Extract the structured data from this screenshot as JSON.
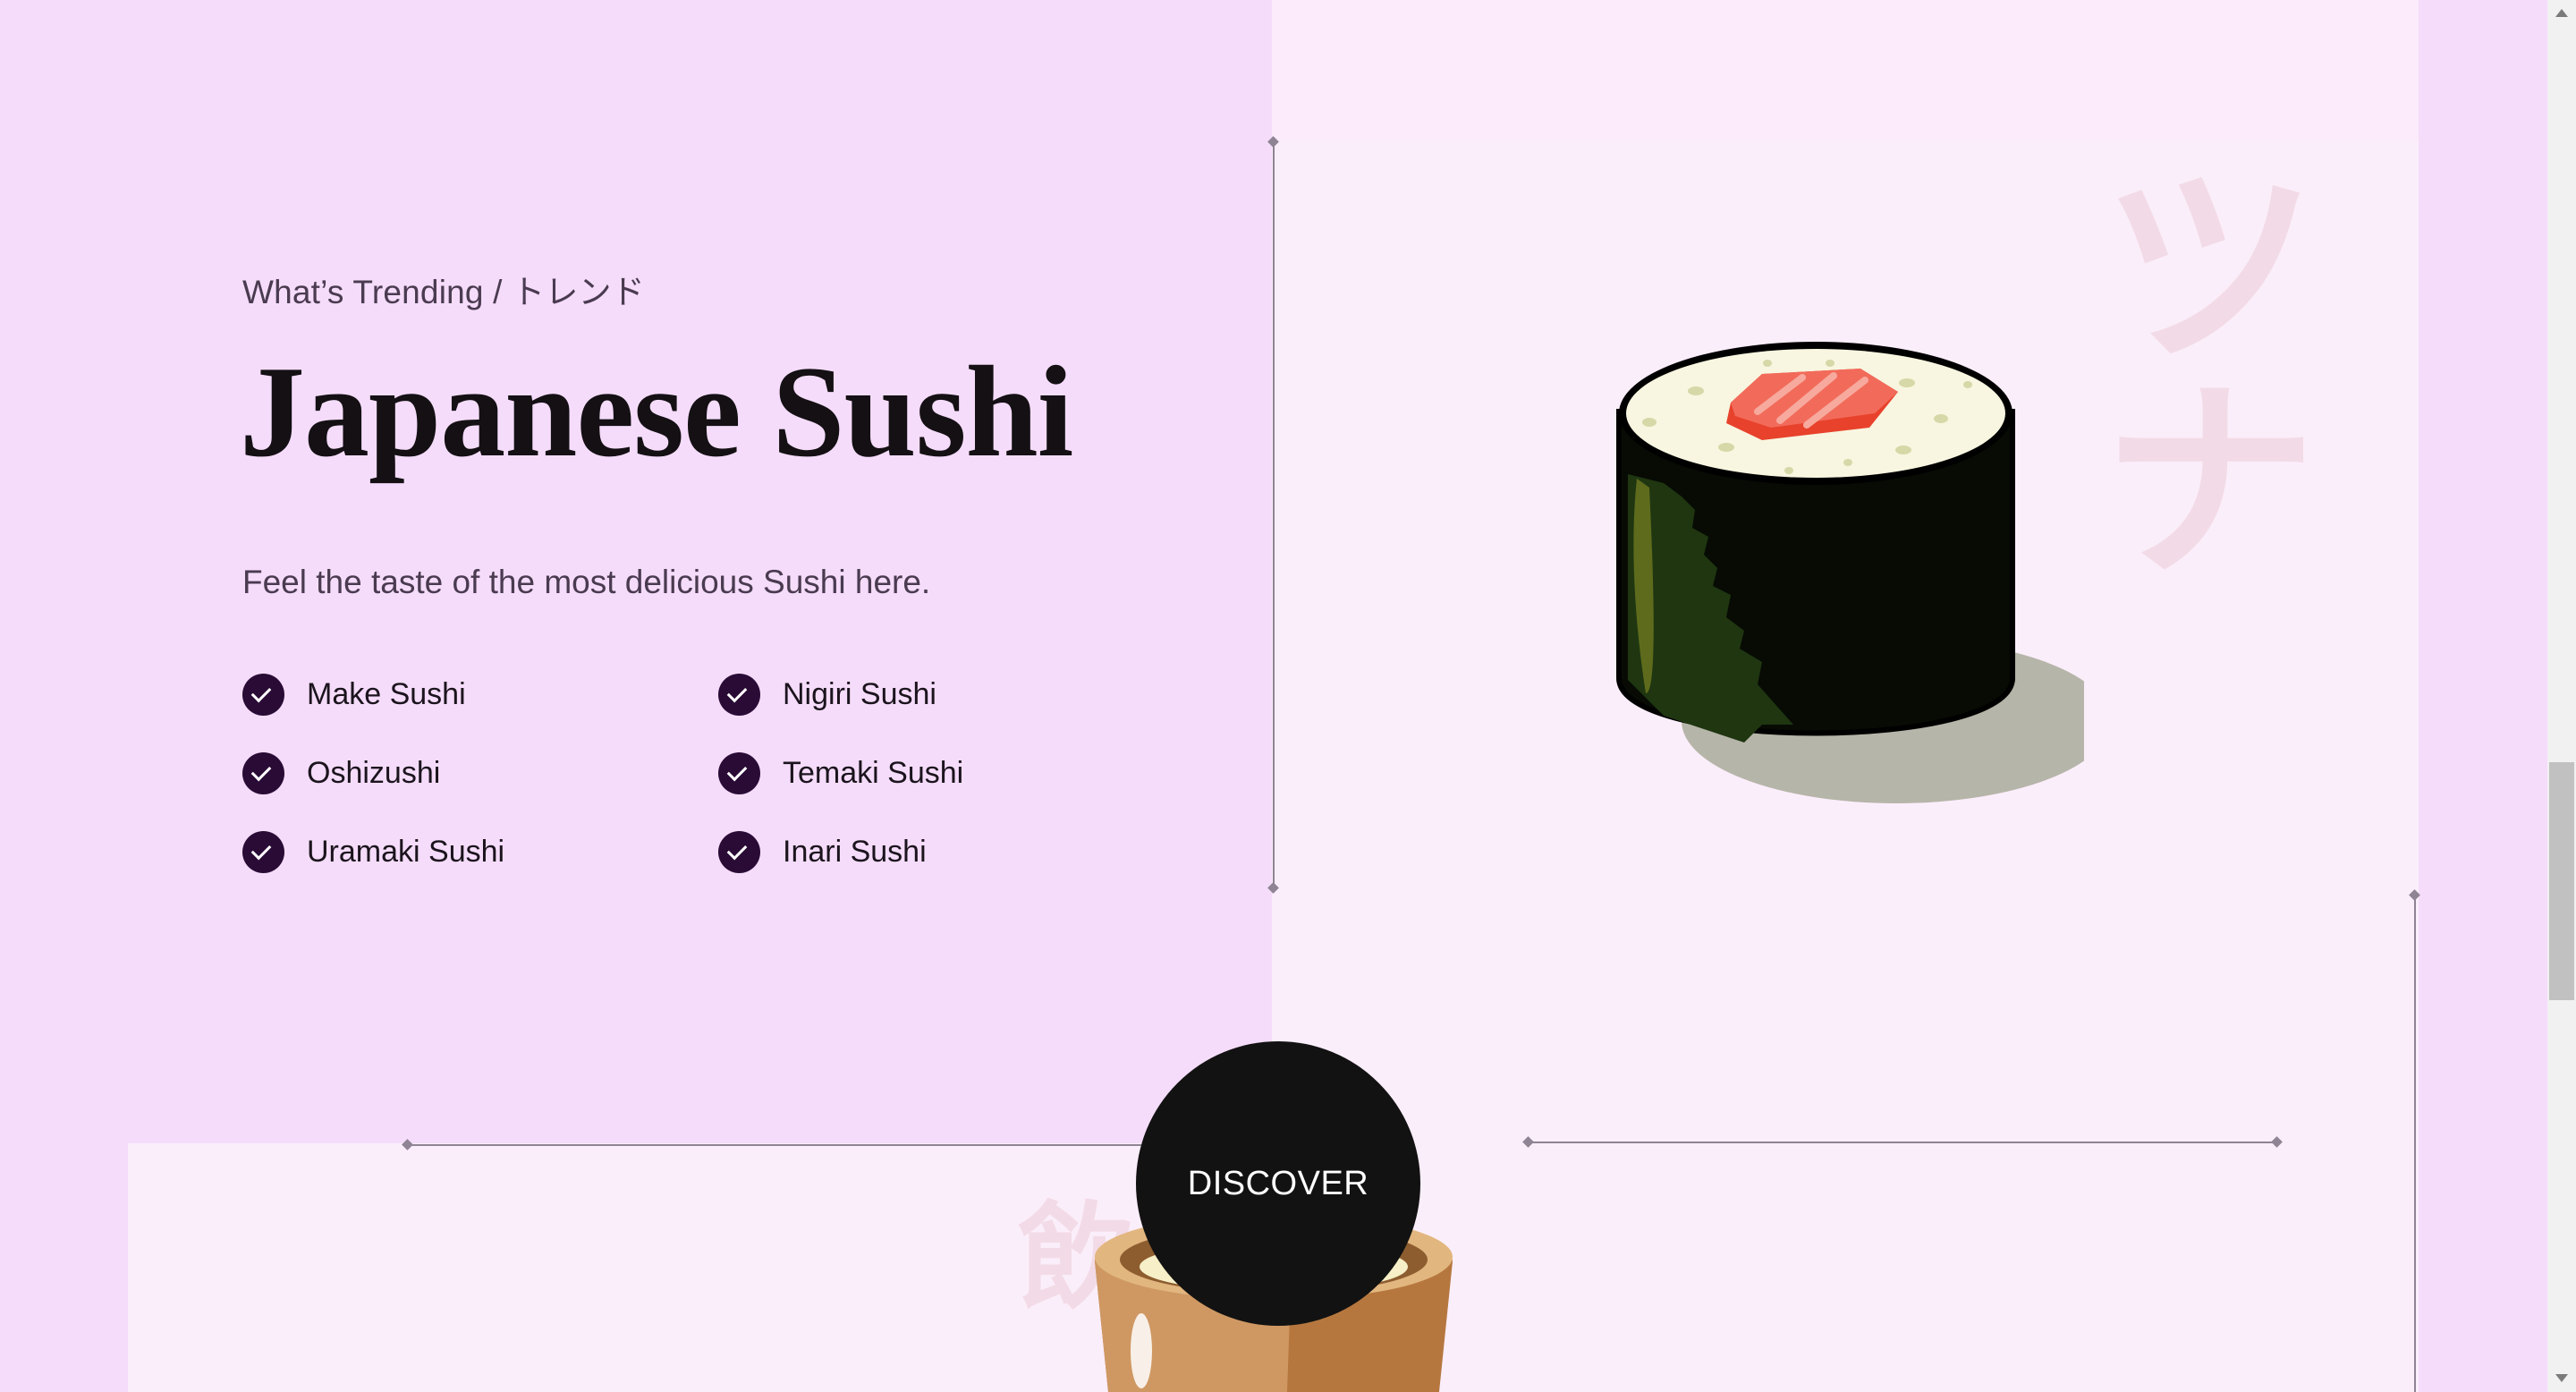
{
  "hero": {
    "eyebrow": "What’s Trending / トレンド",
    "title": "Japanese Sushi",
    "subtitle": "Feel the taste of the most delicious Sushi here."
  },
  "features": {
    "items": [
      {
        "label": "Make Sushi"
      },
      {
        "label": "Nigiri Sushi"
      },
      {
        "label": "Oshizushi"
      },
      {
        "label": "Temaki Sushi"
      },
      {
        "label": "Uramaki Sushi"
      },
      {
        "label": "Inari Sushi"
      }
    ]
  },
  "decor": {
    "kana_top": "ツ",
    "kana_bottom": "ナ",
    "kana_drink": "飲"
  },
  "cta": {
    "discover_label": "DISCOVER"
  },
  "colors": {
    "page_background": "#f5dcfa",
    "panel_background": "#fbeefb",
    "title_color": "#141014",
    "check_badge": "#2a0b36",
    "button_background": "#121212"
  },
  "icons": {
    "check": "check-circle-icon",
    "scroll_up": "scroll-up-arrow-icon",
    "scroll_down": "scroll-down-arrow-icon"
  }
}
